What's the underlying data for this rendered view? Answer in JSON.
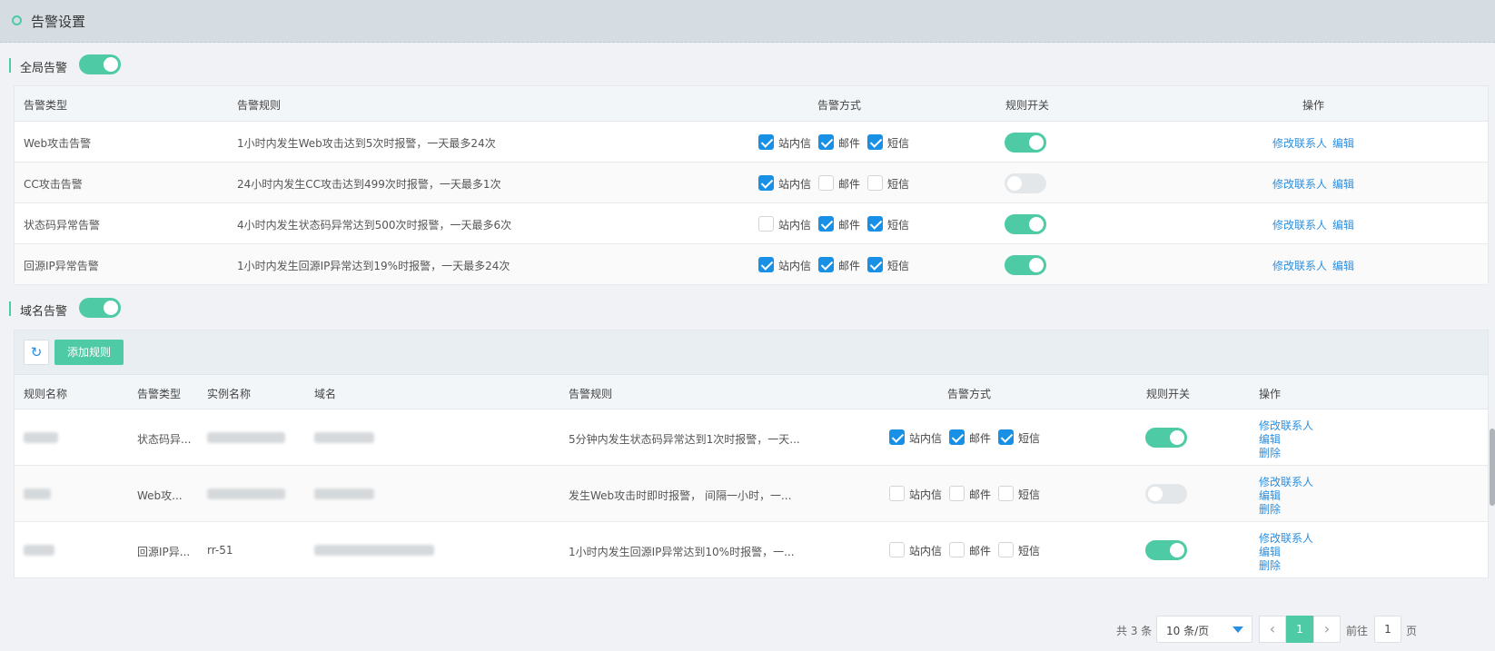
{
  "header": {
    "title": "告警设置"
  },
  "global_section": {
    "label": "全局告警",
    "enabled": true
  },
  "global_table": {
    "columns": [
      "告警类型",
      "告警规则",
      "告警方式",
      "规则开关",
      "操作"
    ],
    "rows": [
      {
        "type": "Web攻击告警",
        "rule": "1小时内发生Web攻击达到5次时报警，一天最多24次",
        "site": true,
        "mail": true,
        "sms": true,
        "switch": true
      },
      {
        "type": "CC攻击告警",
        "rule": "24小时内发生CC攻击达到499次时报警，一天最多1次",
        "site": true,
        "mail": false,
        "sms": false,
        "switch": false
      },
      {
        "type": "状态码异常告警",
        "rule": "4小时内发生状态码异常达到500次时报警，一天最多6次",
        "site": false,
        "mail": true,
        "sms": true,
        "switch": true
      },
      {
        "type": "回源IP异常告警",
        "rule": "1小时内发生回源IP异常达到19%时报警，一天最多24次",
        "site": true,
        "mail": true,
        "sms": true,
        "switch": true
      }
    ],
    "method_labels": {
      "site": "站内信",
      "mail": "邮件",
      "sms": "短信"
    },
    "actions": {
      "contact": "修改联系人",
      "edit": "编辑"
    }
  },
  "domain_section": {
    "label": "域名告警",
    "enabled": true
  },
  "toolbar": {
    "refresh_icon": "refresh-icon",
    "add_label": "添加规则"
  },
  "domain_table": {
    "columns": [
      "规则名称",
      "告警类型",
      "实例名称",
      "域名",
      "告警规则",
      "告警方式",
      "规则开关",
      "操作"
    ],
    "rows": [
      {
        "type": "状态码异...",
        "instance": "",
        "domain": "",
        "rule": "5分钟内发生状态码异常达到1次时报警，一天...",
        "site": true,
        "mail": true,
        "sms": true,
        "switch": true
      },
      {
        "type": "Web攻...",
        "instance": "",
        "domain": "",
        "rule": "发生Web攻击时即时报警， 间隔一小时，一...",
        "site": false,
        "mail": false,
        "sms": false,
        "switch": false
      },
      {
        "type": "回源IP异...",
        "instance": "rr-51",
        "domain": "",
        "rule": "1小时内发生回源IP异常达到10%时报警，一...",
        "site": false,
        "mail": false,
        "sms": false,
        "switch": true
      }
    ],
    "actions": {
      "contact": "修改联系人",
      "edit": "编辑",
      "delete": "删除"
    }
  },
  "pagination": {
    "total": "共 3 条",
    "page_size": "10 条/页",
    "current": "1",
    "goto_prefix": "前往",
    "goto_value": "1",
    "goto_suffix": "页",
    "prev_icon": "chevron-left-icon",
    "next_icon": "chevron-right-icon"
  },
  "colors": {
    "accent": "#4ecba5",
    "link": "#2b8fe0",
    "checkbox": "#1890e6"
  }
}
